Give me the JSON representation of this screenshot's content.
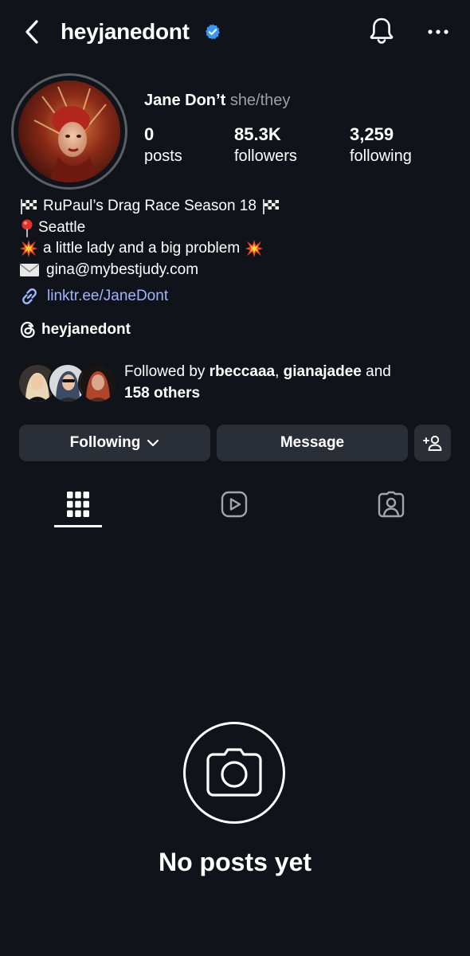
{
  "header": {
    "username": "heyjanedont",
    "verified": true,
    "back_icon": "chevron-left-icon",
    "notifications_icon": "bell-icon",
    "more_icon": "more-horizontal-icon"
  },
  "profile": {
    "display_name": "Jane Don’t",
    "pronouns": "she/they",
    "stats": [
      {
        "value": "0",
        "label": "posts"
      },
      {
        "value": "85.3K",
        "label": "followers"
      },
      {
        "value": "3,259",
        "label": "following"
      }
    ]
  },
  "bio": {
    "lines": [
      {
        "text": "RuPaul’s Drag Race Season 18",
        "icon": "checkered-flag-icon"
      },
      {
        "text": "Seattle",
        "icon": "pushpin-icon"
      },
      {
        "text": "a little lady and a big problem",
        "icon": "collision-icon"
      },
      {
        "text": "gina@mybestjudy.com",
        "icon": "envelope-icon"
      }
    ],
    "link": "linktr.ee/JaneDont",
    "threads_handle": "heyjanedont"
  },
  "followed_by": {
    "prefix": "Followed by ",
    "name1": "rbeccaaa",
    "sep": ", ",
    "name2": "gianajadee",
    "and": " and",
    "others": "158 others"
  },
  "actions": {
    "following_label": "Following",
    "message_label": "Message"
  },
  "tabs": [
    {
      "name": "grid",
      "icon": "grid-icon",
      "active": true
    },
    {
      "name": "reels",
      "icon": "reels-icon",
      "active": false
    },
    {
      "name": "tagged",
      "icon": "tagged-icon",
      "active": false
    }
  ],
  "empty_state": {
    "title": "No posts yet",
    "icon": "camera-icon"
  },
  "colors": {
    "background": "#10141a",
    "button": "#2a2f37",
    "link": "#9db3ff",
    "verified": "#3897f0",
    "muted": "#9aa0a8"
  }
}
